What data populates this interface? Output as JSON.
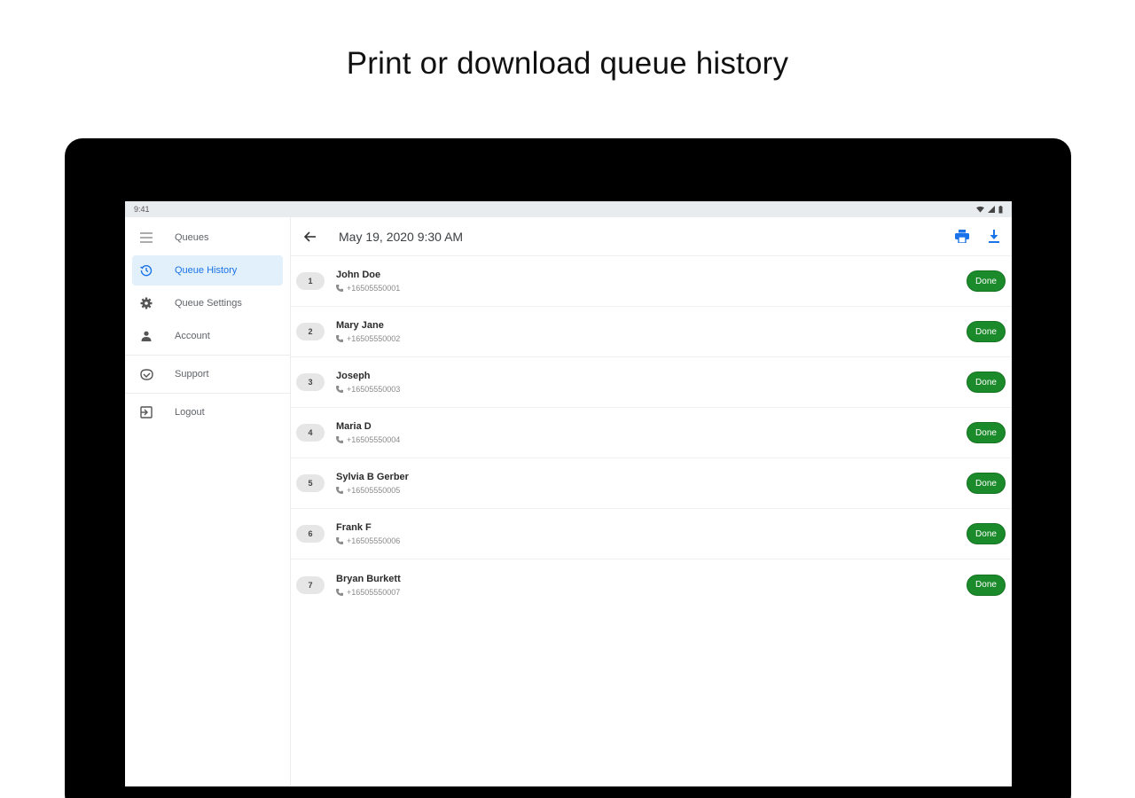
{
  "headline": "Print or download queue history",
  "status_bar": {
    "time": "9:41"
  },
  "sidebar": {
    "items": [
      {
        "label": "Queues",
        "icon": "menu-icon",
        "active": false
      },
      {
        "label": "Queue History",
        "icon": "history-icon",
        "active": true
      },
      {
        "label": "Queue Settings",
        "icon": "gear-icon",
        "active": false
      },
      {
        "label": "Account",
        "icon": "person-icon",
        "active": false
      },
      {
        "label": "Support",
        "icon": "support-icon",
        "active": false
      },
      {
        "label": "Logout",
        "icon": "logout-icon",
        "active": false
      }
    ]
  },
  "toolbar": {
    "title": "May 19, 2020 9:30 AM",
    "print_icon": "print-icon",
    "download_icon": "download-icon"
  },
  "queue": [
    {
      "number": "1",
      "name": "John Doe",
      "phone": "+16505550001",
      "status": "Done"
    },
    {
      "number": "2",
      "name": "Mary Jane",
      "phone": "+16505550002",
      "status": "Done"
    },
    {
      "number": "3",
      "name": "Joseph",
      "phone": "+16505550003",
      "status": "Done"
    },
    {
      "number": "4",
      "name": "Maria D",
      "phone": "+16505550004",
      "status": "Done"
    },
    {
      "number": "5",
      "name": "Sylvia B Gerber",
      "phone": "+16505550005",
      "status": "Done"
    },
    {
      "number": "6",
      "name": "Frank F",
      "phone": "+16505550006",
      "status": "Done"
    },
    {
      "number": "7",
      "name": "Bryan Burkett",
      "phone": "+16505550007",
      "status": "Done"
    }
  ],
  "colors": {
    "accent": "#1a73e8",
    "done_badge": "#1b8a2a",
    "active_nav_bg": "#e1f0fa"
  }
}
